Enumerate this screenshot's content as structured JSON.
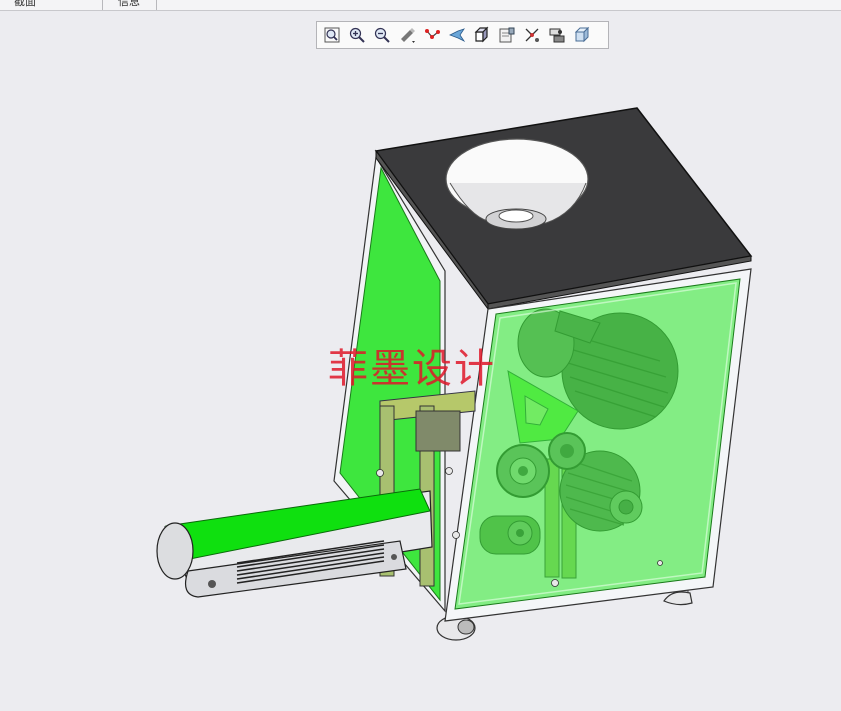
{
  "tabs": [
    {
      "label": "截面"
    },
    {
      "label": "信息"
    }
  ],
  "toolbar": {
    "buttons": [
      {
        "name": "zoom-fit-button",
        "icon": "zoom-fit-icon"
      },
      {
        "name": "zoom-in-button",
        "icon": "zoom-in-icon"
      },
      {
        "name": "zoom-out-button",
        "icon": "zoom-out-icon"
      },
      {
        "name": "display-style-button",
        "icon": "display-style-icon"
      },
      {
        "name": "datum-display-button",
        "icon": "datum-icon"
      },
      {
        "name": "orient-button",
        "icon": "orient-icon"
      },
      {
        "name": "saved-views-button",
        "icon": "cube-view-icon"
      },
      {
        "name": "section-button",
        "icon": "section-icon"
      },
      {
        "name": "explode-button",
        "icon": "explode-icon"
      },
      {
        "name": "appearance-button",
        "icon": "appearance-icon"
      },
      {
        "name": "perspective-button",
        "icon": "perspective-icon"
      }
    ]
  },
  "watermark": {
    "text": "菲墨设计"
  },
  "colors": {
    "background": "#ececf0",
    "panel_green": "#3ee63e",
    "frame_white": "#f4f6f8",
    "top_plate": "#3a3a3c",
    "motor_gray": "#5a5e58"
  }
}
